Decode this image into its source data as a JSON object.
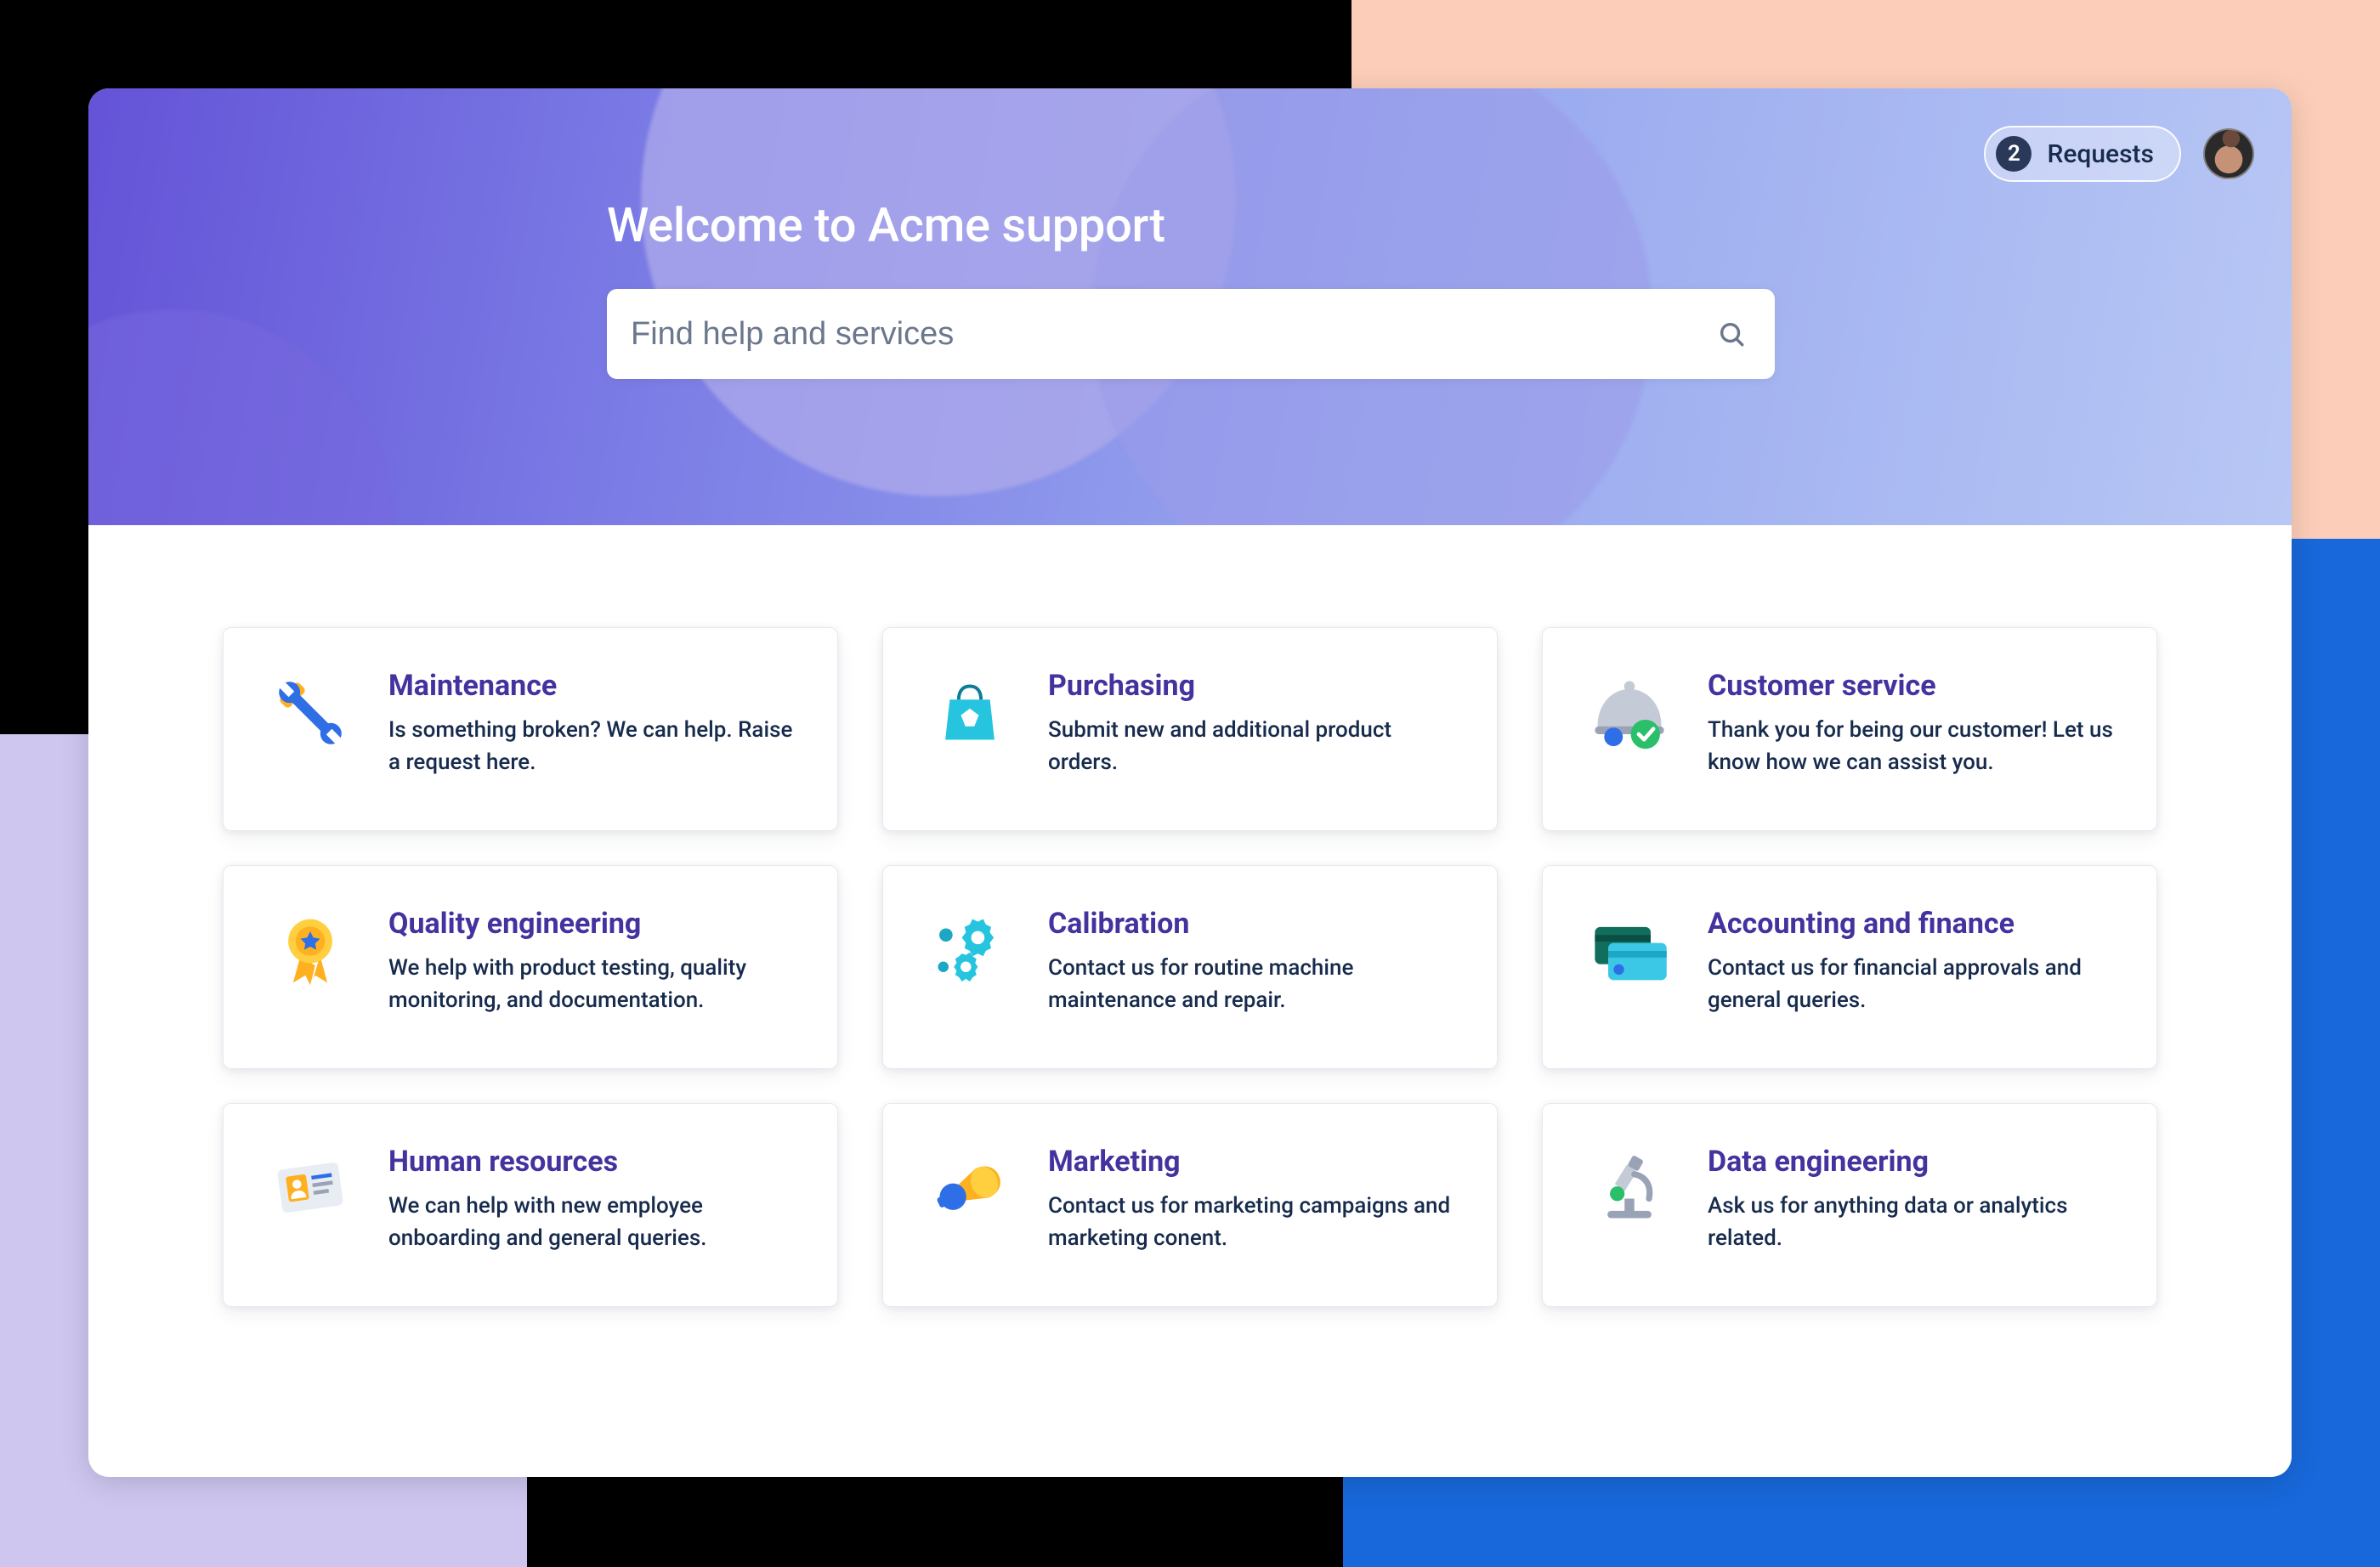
{
  "header": {
    "welcome_title": "Welcome to Acme support",
    "search_placeholder": "Find help and services",
    "requests_count": "2",
    "requests_label": "Requests"
  },
  "cards": [
    {
      "id": "maintenance",
      "title": "Maintenance",
      "description": "Is something broken? We can help. Raise a request here.",
      "icon": "tools-icon"
    },
    {
      "id": "purchasing",
      "title": "Purchasing",
      "description": "Submit new and additional product orders.",
      "icon": "shopping-bag-icon"
    },
    {
      "id": "customer-service",
      "title": "Customer service",
      "description": "Thank you for being our customer! Let us know how we can assist you.",
      "icon": "cloche-check-icon"
    },
    {
      "id": "quality-engineering",
      "title": "Quality engineering",
      "description": "We help with product testing, quality monitoring, and documentation.",
      "icon": "ribbon-award-icon"
    },
    {
      "id": "calibration",
      "title": "Calibration",
      "description": "Contact us for routine machine maintenance and repair.",
      "icon": "gears-icon"
    },
    {
      "id": "accounting-finance",
      "title": "Accounting and finance",
      "description": "Contact us for financial approvals and general queries.",
      "icon": "credit-cards-icon"
    },
    {
      "id": "human-resources",
      "title": "Human resources",
      "description": "We can help with new employee onboarding and general queries.",
      "icon": "id-card-icon"
    },
    {
      "id": "marketing",
      "title": "Marketing",
      "description": "Contact us for marketing campaigns and marketing conent.",
      "icon": "megaphone-icon"
    },
    {
      "id": "data-engineering",
      "title": "Data engineering",
      "description": "Ask us for anything data or analytics related.",
      "icon": "microscope-icon"
    }
  ]
}
